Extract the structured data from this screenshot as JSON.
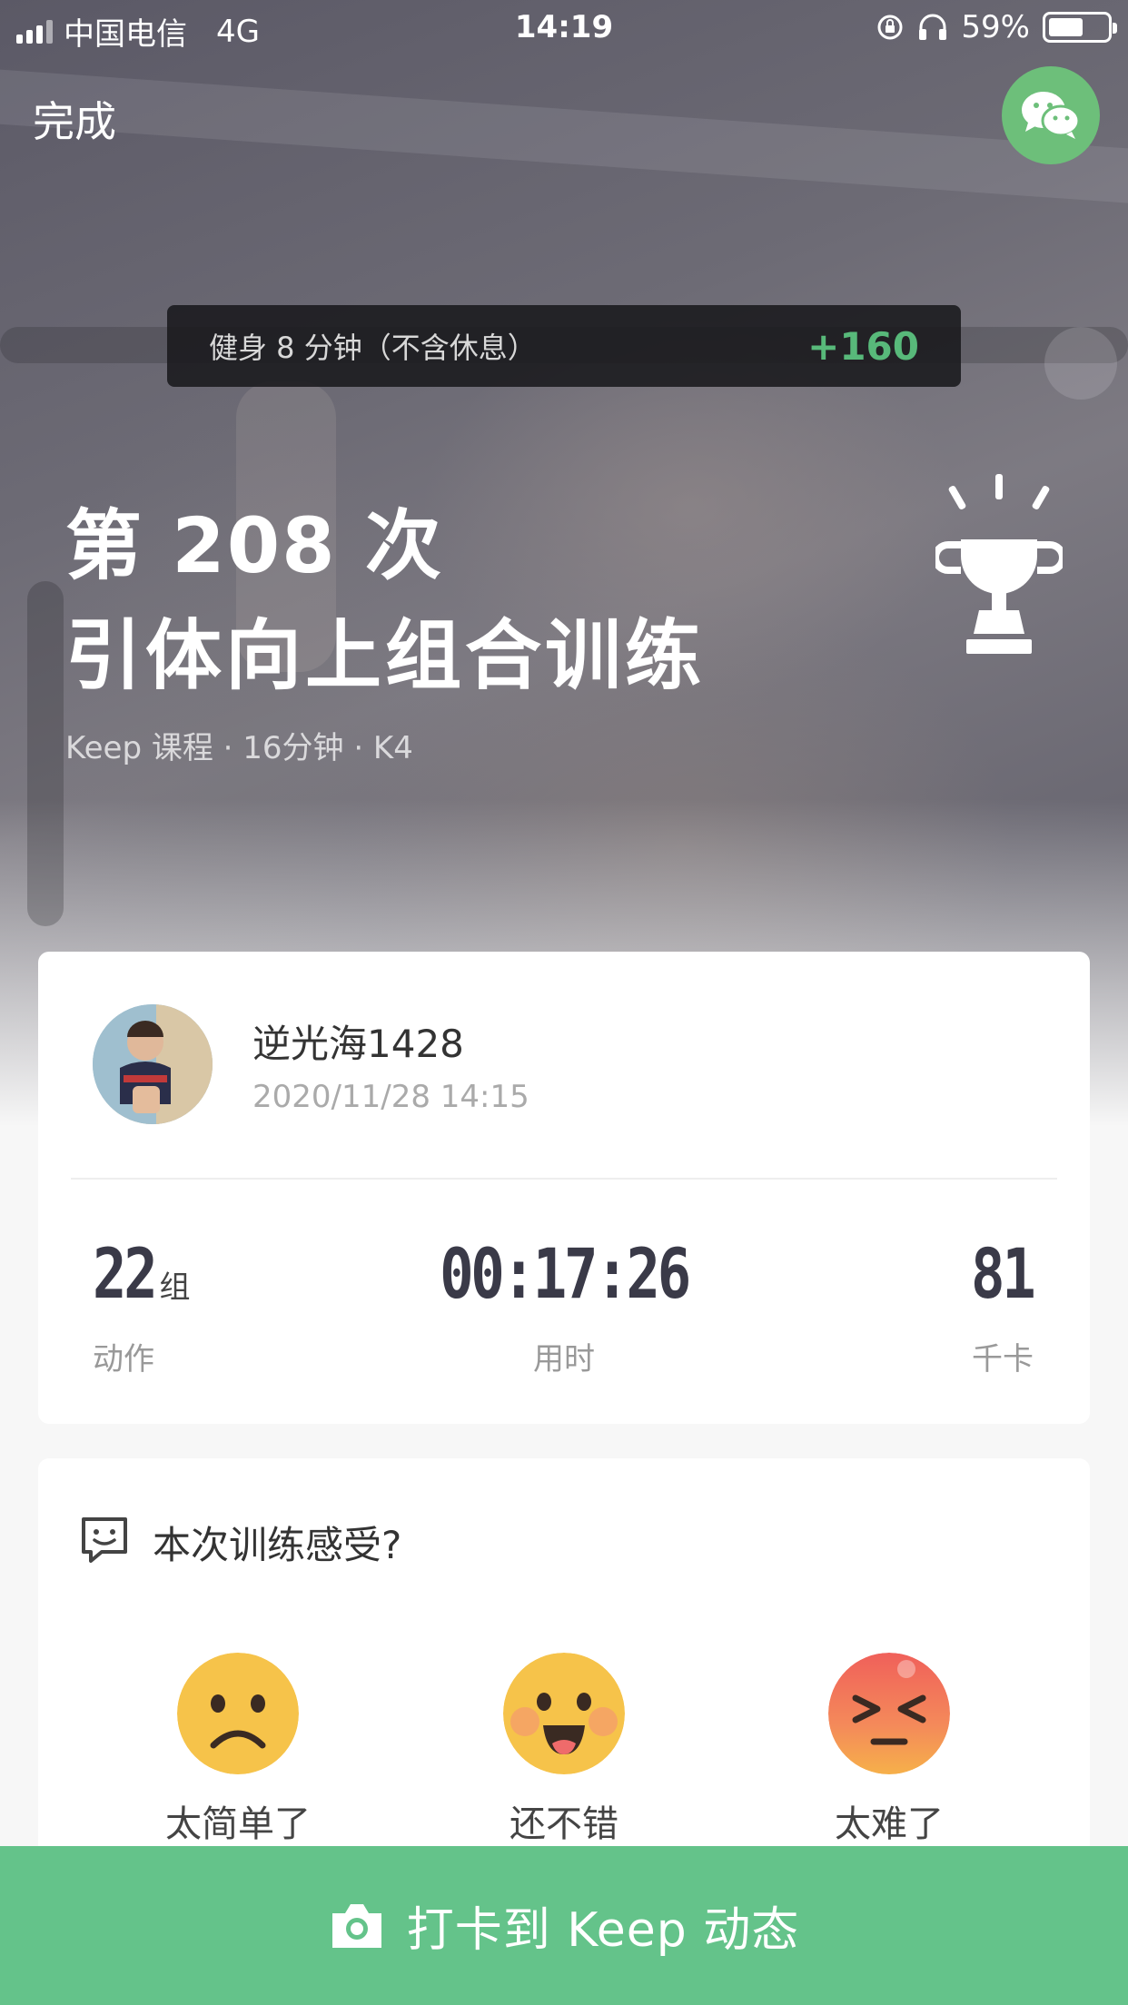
{
  "status_bar": {
    "carrier": "中国电信",
    "network": "4G",
    "time": "14:19",
    "battery": "59%",
    "battery_level": 0.59
  },
  "header": {
    "done_label": "完成",
    "share_icon": "wechat-icon"
  },
  "reward": {
    "text": "健身 8 分钟（不含休息）",
    "points": "+160"
  },
  "workout": {
    "count_line": "第 208 次",
    "name": "引体向上组合训练",
    "meta": "Keep 课程 · 16分钟 · K4"
  },
  "user": {
    "name": "逆光海1428",
    "datetime": "2020/11/28 14:15"
  },
  "stats": [
    {
      "value": "22",
      "unit": "组",
      "label": "动作"
    },
    {
      "value": "00:17:26",
      "unit": "",
      "label": "用时"
    },
    {
      "value": "81",
      "unit": "",
      "label": "千卡"
    }
  ],
  "feedback": {
    "question": "本次训练感受?",
    "options": [
      {
        "label": "太简单了",
        "icon": "sad-face-icon"
      },
      {
        "label": "还不错",
        "icon": "happy-face-icon"
      },
      {
        "label": "太难了",
        "icon": "angry-face-icon"
      }
    ]
  },
  "checkin": {
    "label": "打卡到 Keep 动态",
    "icon": "camera-icon"
  },
  "colors": {
    "accent_green": "#64c38a",
    "points_green": "#58b97a",
    "wechat_green": "#6dbf7a"
  }
}
